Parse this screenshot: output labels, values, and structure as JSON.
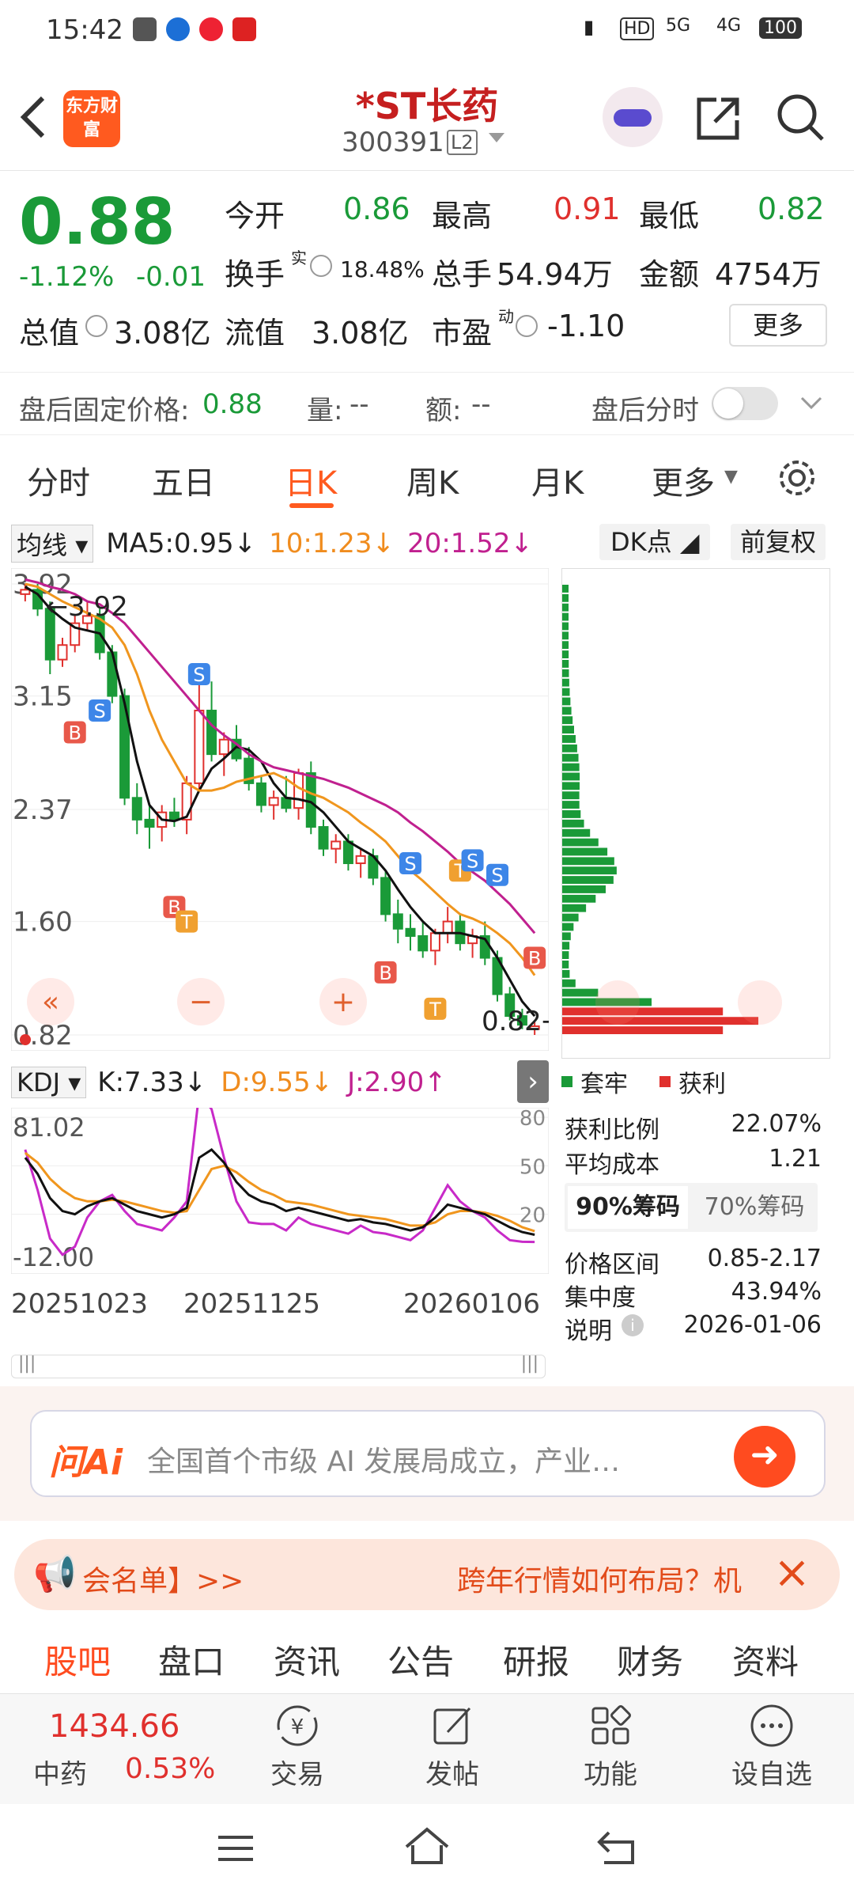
{
  "status": {
    "time": "15:42",
    "hd": "HD",
    "net1": "5G",
    "net2": "4G",
    "battery": "100"
  },
  "header": {
    "logo_text": "东方财富",
    "title": "*ST长药",
    "code": "300391",
    "level": "L2"
  },
  "quote": {
    "price": "0.88",
    "pct": "-1.12%",
    "chg": "-0.01",
    "open_label": "今开",
    "open": "0.86",
    "high_label": "最高",
    "high": "0.91",
    "low_label": "最低",
    "low": "0.82",
    "turnover_label": "换手",
    "turnover_sup": "实",
    "turnover": "18.48%",
    "volume_label": "总手",
    "volume": "54.94万",
    "amount_label": "金额",
    "amount": "4754万",
    "mcap_label": "总值",
    "mcap": "3.08亿",
    "float_label": "流值",
    "float": "3.08亿",
    "pe_label": "市盈",
    "pe_sup": "动",
    "pe": "-1.10",
    "more_button": "更多"
  },
  "after_hours": {
    "label": "盘后固定价格:",
    "price": "0.88",
    "vol_label": "量:",
    "vol": "--",
    "amt_label": "额:",
    "amt": "--",
    "intraday_label": "盘后分时"
  },
  "tabs": [
    {
      "label": "分时"
    },
    {
      "label": "五日"
    },
    {
      "label": "日K"
    },
    {
      "label": "周K"
    },
    {
      "label": "月K"
    },
    {
      "label": "更多"
    }
  ],
  "ma_legend": {
    "selector": "均线",
    "ma5": "MA5:0.95",
    "ma10": "10:1.23",
    "ma20": "20:1.52",
    "dk_button": "DK点",
    "adjust_button": "前复权"
  },
  "colors": {
    "up": "#e0302d",
    "down": "#1a9a38",
    "ma5": "#111111",
    "ma10": "#f0961e",
    "ma20": "#c0208f",
    "accent": "#ff6a1a"
  },
  "chart_data": {
    "type": "candlestick",
    "y_ticks": [
      "3.92",
      "3.15",
      "2.37",
      "1.60",
      "0.82"
    ],
    "ylim": [
      0.82,
      3.92
    ],
    "annotations": {
      "max_label": "3.92",
      "min_label": "0.82"
    },
    "signals": [
      "B",
      "S",
      "T"
    ],
    "ohlc": [
      [
        3.85,
        3.92,
        3.8,
        3.88
      ],
      [
        3.88,
        3.92,
        3.7,
        3.75
      ],
      [
        3.75,
        3.8,
        3.3,
        3.4
      ],
      [
        3.4,
        3.55,
        3.35,
        3.5
      ],
      [
        3.5,
        3.7,
        3.45,
        3.65
      ],
      [
        3.65,
        3.8,
        3.6,
        3.7
      ],
      [
        3.7,
        3.75,
        3.4,
        3.45
      ],
      [
        3.45,
        3.5,
        3.1,
        3.15
      ],
      [
        3.15,
        3.2,
        2.4,
        2.45
      ],
      [
        2.45,
        2.55,
        2.2,
        2.3
      ],
      [
        2.3,
        2.4,
        2.1,
        2.25
      ],
      [
        2.25,
        2.4,
        2.15,
        2.35
      ],
      [
        2.35,
        2.45,
        2.25,
        2.3
      ],
      [
        2.3,
        2.6,
        2.2,
        2.55
      ],
      [
        2.55,
        3.3,
        2.5,
        3.05
      ],
      [
        3.05,
        3.25,
        2.7,
        2.75
      ],
      [
        2.75,
        2.9,
        2.6,
        2.85
      ],
      [
        2.85,
        2.95,
        2.7,
        2.72
      ],
      [
        2.72,
        2.8,
        2.5,
        2.55
      ],
      [
        2.55,
        2.6,
        2.35,
        2.4
      ],
      [
        2.4,
        2.5,
        2.3,
        2.45
      ],
      [
        2.45,
        2.6,
        2.35,
        2.38
      ],
      [
        2.38,
        2.65,
        2.3,
        2.62
      ],
      [
        2.62,
        2.7,
        2.2,
        2.25
      ],
      [
        2.25,
        2.3,
        2.05,
        2.1
      ],
      [
        2.1,
        2.2,
        2.0,
        2.15
      ],
      [
        2.15,
        2.2,
        1.95,
        2.0
      ],
      [
        2.0,
        2.1,
        1.9,
        2.05
      ],
      [
        2.05,
        2.1,
        1.85,
        1.9
      ],
      [
        1.9,
        1.95,
        1.6,
        1.65
      ],
      [
        1.65,
        1.75,
        1.45,
        1.55
      ],
      [
        1.55,
        1.65,
        1.4,
        1.5
      ],
      [
        1.5,
        1.6,
        1.35,
        1.4
      ],
      [
        1.4,
        1.55,
        1.3,
        1.52
      ],
      [
        1.52,
        1.7,
        1.45,
        1.6
      ],
      [
        1.6,
        1.65,
        1.4,
        1.45
      ],
      [
        1.45,
        1.55,
        1.35,
        1.5
      ],
      [
        1.5,
        1.6,
        1.3,
        1.35
      ],
      [
        1.35,
        1.4,
        1.05,
        1.1
      ],
      [
        1.1,
        1.15,
        0.92,
        0.95
      ],
      [
        0.95,
        1.0,
        0.86,
        0.89
      ],
      [
        0.86,
        0.91,
        0.82,
        0.88
      ]
    ],
    "ma5": [
      3.9,
      3.85,
      3.75,
      3.68,
      3.62,
      3.6,
      3.58,
      3.45,
      3.1,
      2.7,
      2.4,
      2.3,
      2.29,
      2.32,
      2.5,
      2.65,
      2.72,
      2.8,
      2.78,
      2.7,
      2.55,
      2.45,
      2.44,
      2.42,
      2.35,
      2.25,
      2.15,
      2.1,
      2.05,
      1.95,
      1.82,
      1.7,
      1.6,
      1.52,
      1.52,
      1.52,
      1.5,
      1.48,
      1.35,
      1.2,
      1.05,
      0.95
    ],
    "ma10": [
      3.92,
      3.9,
      3.85,
      3.8,
      3.76,
      3.72,
      3.68,
      3.62,
      3.5,
      3.3,
      3.05,
      2.85,
      2.7,
      2.55,
      2.5,
      2.5,
      2.52,
      2.56,
      2.58,
      2.6,
      2.62,
      2.58,
      2.52,
      2.48,
      2.45,
      2.4,
      2.35,
      2.28,
      2.22,
      2.15,
      2.05,
      1.95,
      1.88,
      1.8,
      1.72,
      1.65,
      1.62,
      1.58,
      1.52,
      1.45,
      1.35,
      1.23
    ],
    "ma20": [
      3.95,
      3.93,
      3.9,
      3.88,
      3.85,
      3.8,
      3.78,
      3.72,
      3.65,
      3.55,
      3.45,
      3.35,
      3.25,
      3.15,
      3.05,
      2.95,
      2.88,
      2.82,
      2.75,
      2.7,
      2.66,
      2.64,
      2.62,
      2.6,
      2.58,
      2.55,
      2.52,
      2.48,
      2.44,
      2.4,
      2.35,
      2.28,
      2.22,
      2.15,
      2.08,
      2.0,
      1.94,
      1.88,
      1.8,
      1.72,
      1.62,
      1.52
    ],
    "kdj": {
      "legend": {
        "selector": "KDJ",
        "k": "K:7.33",
        "d": "D:9.55",
        "j": "J:2.90"
      },
      "y_ticks_left": [
        "81.02",
        "-12.00"
      ],
      "y_ticks_right": [
        "80",
        "50",
        "20"
      ],
      "ylim": [
        -12,
        81.02
      ],
      "K": [
        55,
        45,
        30,
        22,
        20,
        25,
        28,
        30,
        26,
        22,
        20,
        18,
        20,
        24,
        55,
        60,
        52,
        40,
        32,
        28,
        26,
        22,
        24,
        22,
        20,
        18,
        16,
        17,
        15,
        14,
        12,
        10,
        12,
        18,
        26,
        24,
        22,
        20,
        16,
        12,
        9,
        7.33
      ],
      "D": [
        58,
        52,
        42,
        35,
        30,
        28,
        28,
        29,
        28,
        26,
        24,
        22,
        21,
        22,
        35,
        48,
        50,
        46,
        40,
        35,
        32,
        28,
        27,
        26,
        24,
        22,
        20,
        19,
        18,
        17,
        15,
        13,
        13,
        15,
        20,
        22,
        22,
        21,
        19,
        16,
        12,
        9.55
      ],
      "J": [
        60,
        35,
        5,
        -5,
        0,
        18,
        28,
        32,
        22,
        14,
        12,
        10,
        18,
        28,
        95,
        85,
        55,
        28,
        15,
        14,
        14,
        10,
        18,
        14,
        12,
        10,
        8,
        13,
        9,
        8,
        6,
        4,
        10,
        24,
        38,
        28,
        22,
        18,
        10,
        4,
        3,
        2.9
      ]
    },
    "x_labels": [
      "20251023",
      "20251125",
      "20260106"
    ]
  },
  "chip": {
    "legend_trapped": "套牢",
    "legend_profit": "获利",
    "profit_ratio_label": "获利比例",
    "profit_ratio": "22.07%",
    "avg_cost_label": "平均成本",
    "avg_cost": "1.21",
    "tab90": "90%筹码",
    "tab70": "70%筹码",
    "range_label": "价格区间",
    "range": "0.85-2.17",
    "concentration_label": "集中度",
    "concentration": "43.94%",
    "note_label": "说明",
    "date": "2026-01-06"
  },
  "ai": {
    "logo": "问Ai",
    "placeholder": "全国首个市级 AI 发展局成立，产业…"
  },
  "notice": {
    "left_text": "会名单】>>",
    "right_text": "跨年行情如何布局？机"
  },
  "bottom_tabs": [
    "股吧",
    "盘口",
    "资讯",
    "公告",
    "研报",
    "财务",
    "资料"
  ],
  "toolbar": {
    "index_value": "1434.66",
    "index_name": "中药",
    "index_pct": "0.53%",
    "trade": "交易",
    "post": "发帖",
    "func": "功能",
    "watch": "设自选"
  }
}
